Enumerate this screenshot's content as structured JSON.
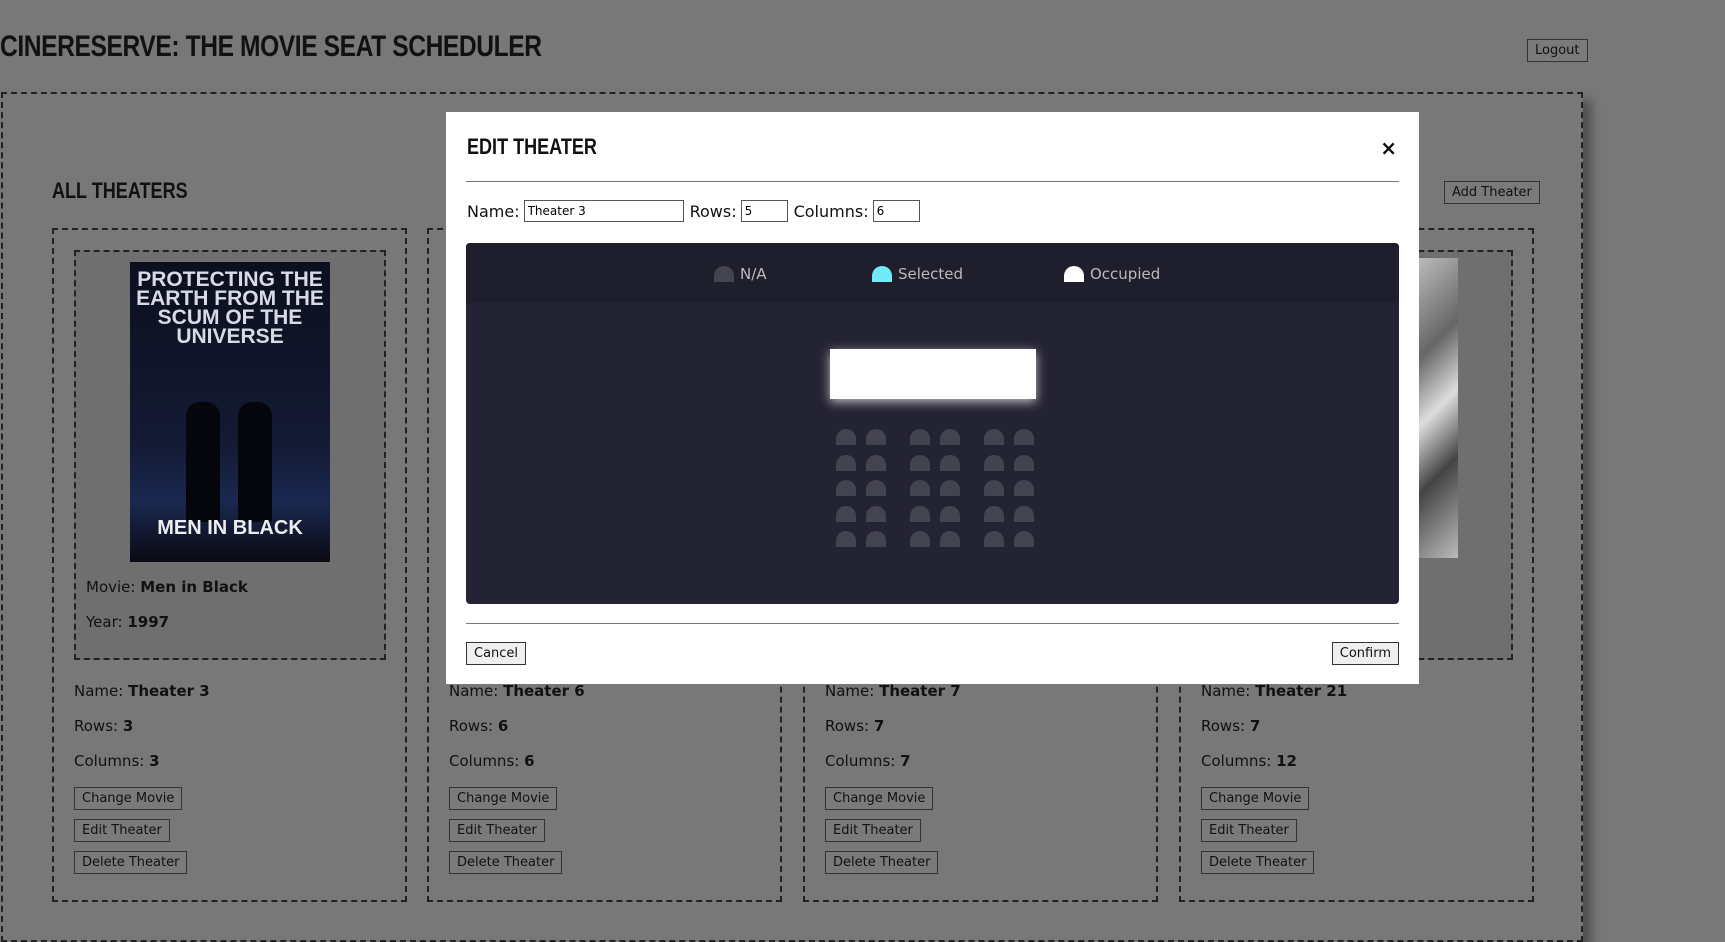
{
  "header": {
    "title": "CINEREServe: The Movie Seat Scheduler",
    "logout_label": "Logout"
  },
  "main": {
    "section_title": "All Theaters",
    "add_theater_label": "Add Theater",
    "labels": {
      "movie": "Movie:",
      "year": "Year:",
      "name": "Name:",
      "rows": "Rows:",
      "columns": "Columns:"
    },
    "buttons": {
      "change_movie": "Change Movie",
      "edit_theater": "Edit Theater",
      "delete_theater": "Delete Theater"
    },
    "cards": [
      {
        "movie": "Men in Black",
        "year": "1997",
        "poster_tagline": "PROTECTING THE EARTH FROM THE SCUM OF THE UNIVERSE",
        "poster_title": "MEN IN BLACK",
        "name": "Theater 3",
        "rows": "3",
        "columns": "3"
      },
      {
        "name": "Theater 6",
        "rows": "6",
        "columns": "6"
      },
      {
        "name": "Theater 7",
        "rows": "7",
        "columns": "7"
      },
      {
        "name": "Theater 21",
        "rows": "7",
        "columns": "12"
      }
    ]
  },
  "modal": {
    "title": "Edit Theater",
    "close_label": "×",
    "name_label": "Name:",
    "name_value": "Theater 3",
    "rows_label": "Rows:",
    "rows_value": "5",
    "columns_label": "Columns:",
    "columns_value": "6",
    "legend": [
      {
        "label": "N/A",
        "color": "#444451"
      },
      {
        "label": "Selected",
        "color": "#6feaf6"
      },
      {
        "label": "Occupied",
        "color": "#ffffff"
      }
    ],
    "seat_rows": 5,
    "seat_columns": 6,
    "cancel_label": "Cancel",
    "confirm_label": "Confirm"
  }
}
